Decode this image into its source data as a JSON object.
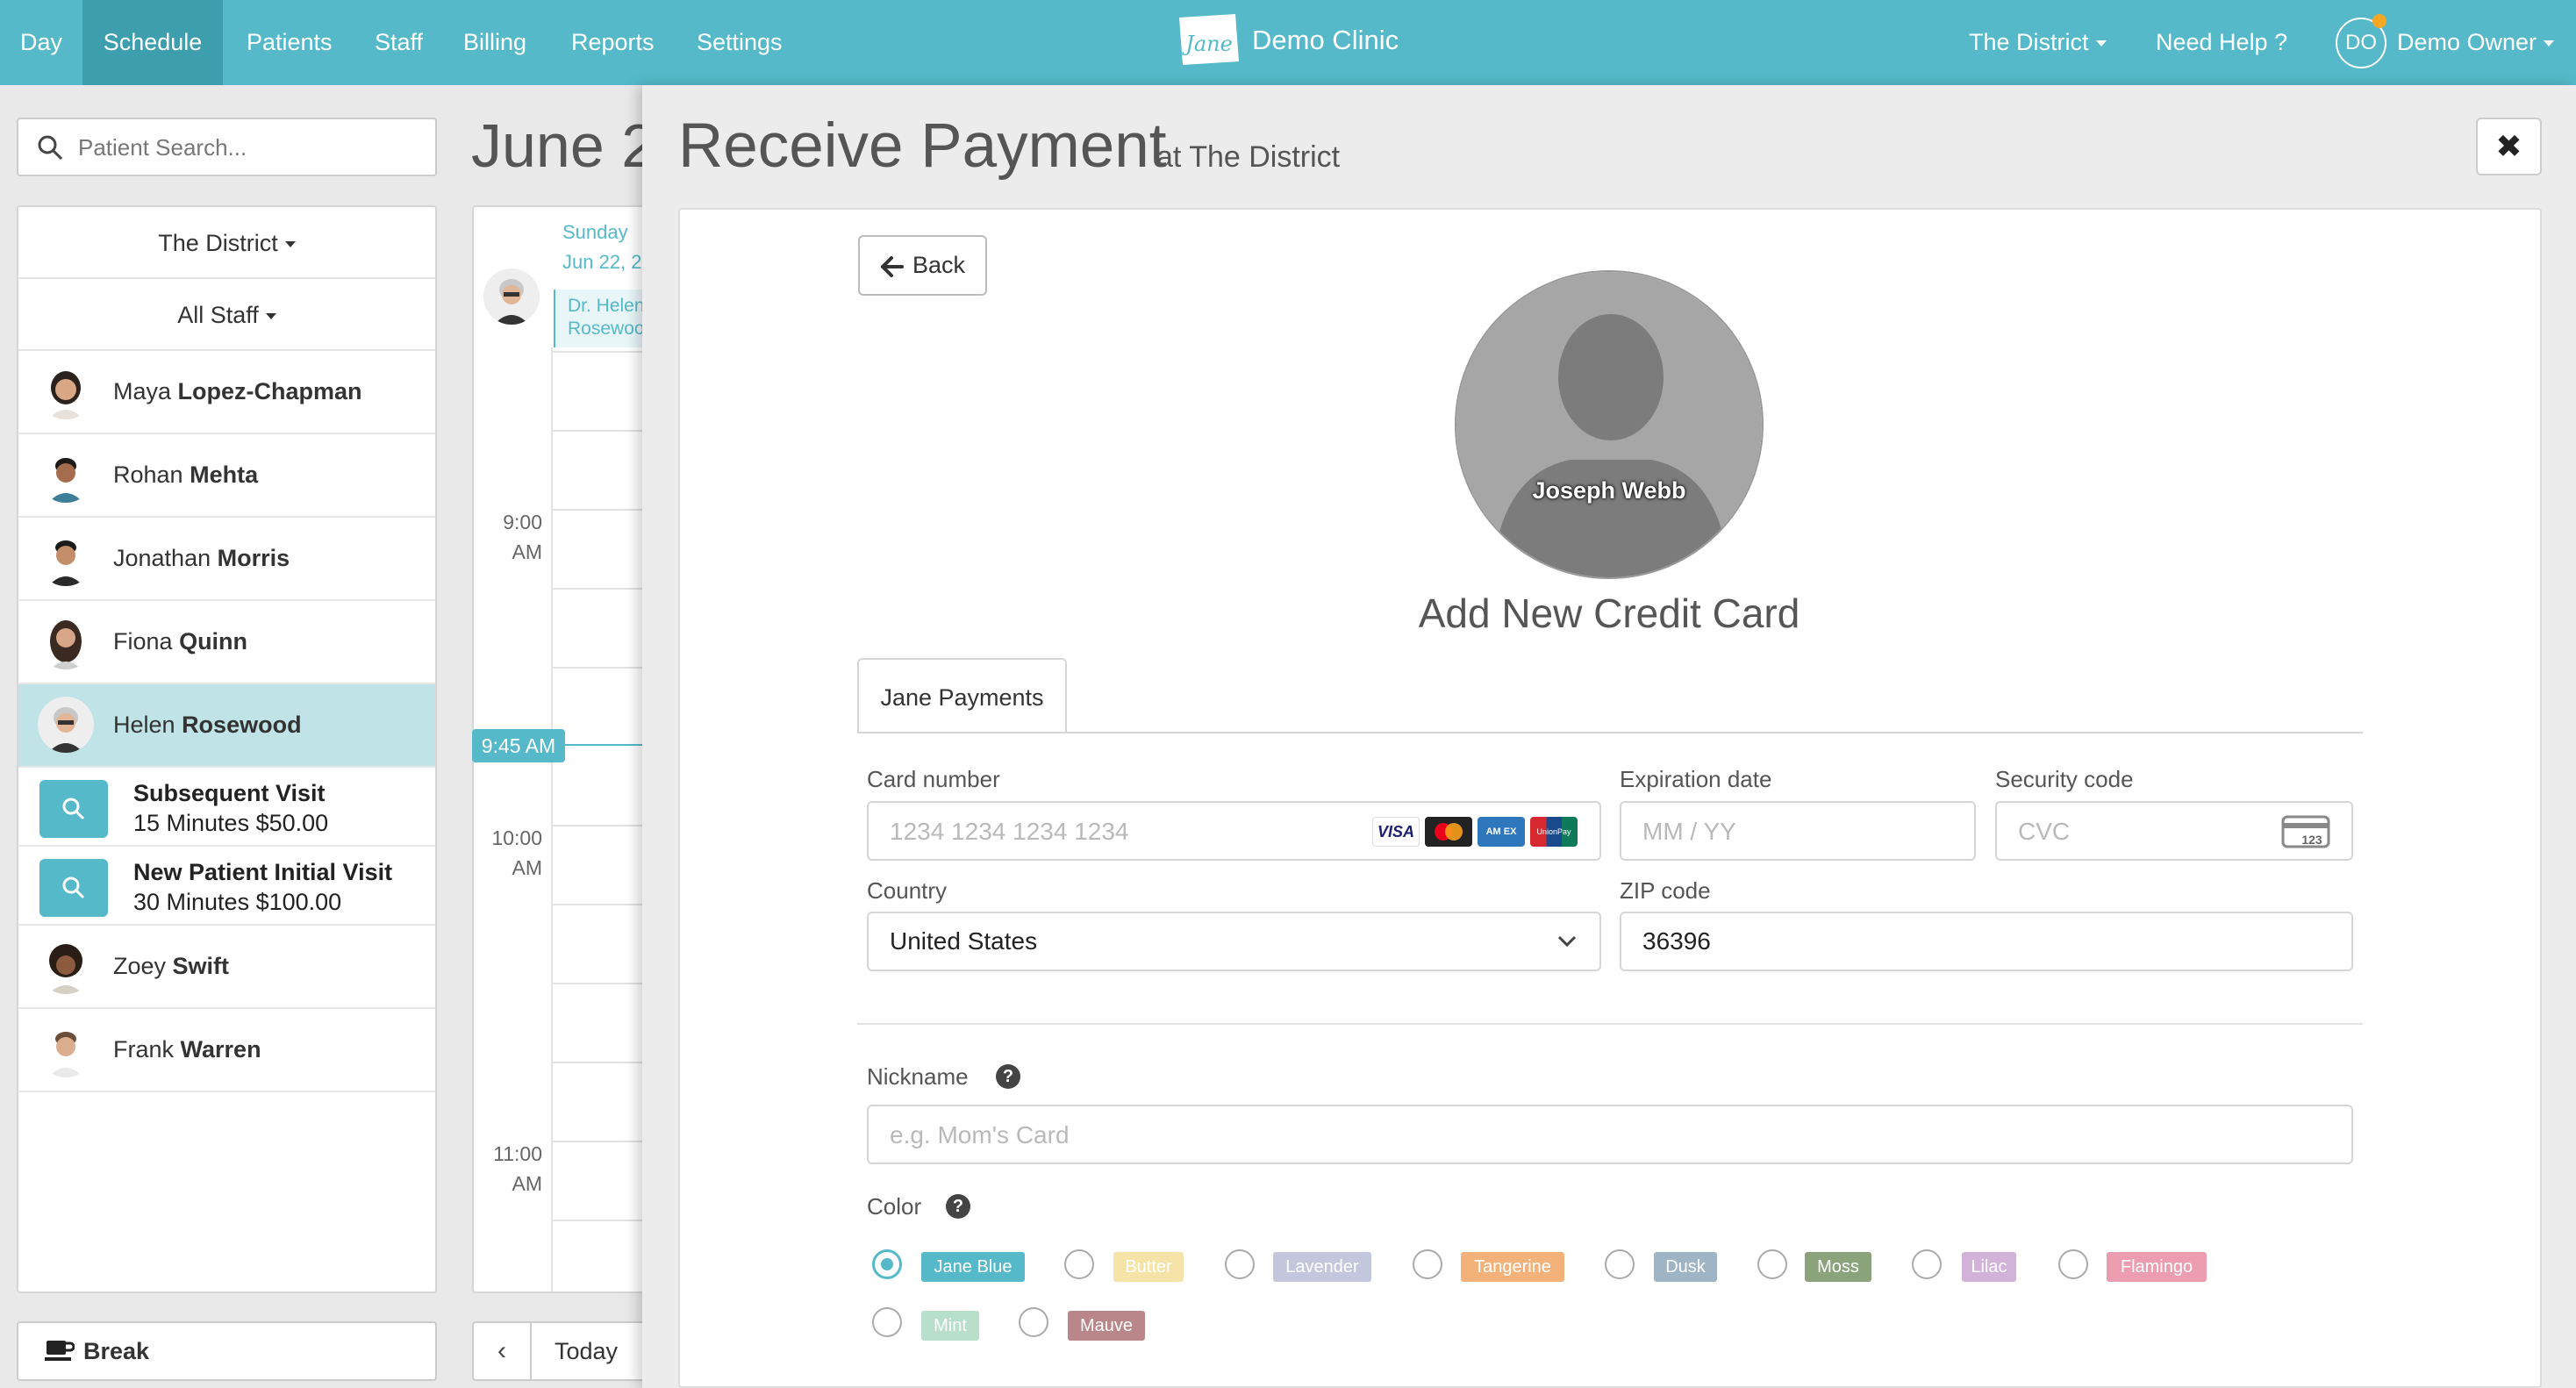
{
  "nav": {
    "items": [
      {
        "label": "Day"
      },
      {
        "label": "Schedule"
      },
      {
        "label": "Patients"
      },
      {
        "label": "Staff"
      },
      {
        "label": "Billing"
      },
      {
        "label": "Reports"
      },
      {
        "label": "Settings"
      }
    ],
    "logo_text": "Jane",
    "clinic_name": "Demo Clinic",
    "location": "The District",
    "help": "Need Help ?",
    "user_initials": "DO",
    "user_name": "Demo Owner"
  },
  "sidebar": {
    "search_placeholder": "Patient Search...",
    "location_filter": "The District",
    "staff_filter": "All Staff",
    "staff": [
      {
        "first": "Maya",
        "last": "Lopez-Chapman"
      },
      {
        "first": "Rohan",
        "last": "Mehta"
      },
      {
        "first": "Jonathan",
        "last": "Morris"
      },
      {
        "first": "Fiona",
        "last": "Quinn"
      },
      {
        "first": "Helen",
        "last": "Rosewood"
      },
      {
        "first": "Zoey",
        "last": "Swift"
      },
      {
        "first": "Frank",
        "last": "Warren"
      }
    ],
    "services": [
      {
        "title": "Subsequent Visit",
        "detail": "15 Minutes $50.00"
      },
      {
        "title": "New Patient Initial Visit",
        "detail": "30 Minutes $100.00"
      }
    ],
    "break_label": "Break"
  },
  "calendar": {
    "title": "June 2",
    "day_name": "Sunday",
    "day_date": "Jun 22, 2",
    "practitioner_line1": "Dr. Helen",
    "practitioner_line2": "Rosewood",
    "times": [
      {
        "hour": "9:00",
        "ampm": "AM"
      },
      {
        "hour": "10:00",
        "ampm": "AM"
      },
      {
        "hour": "11:00",
        "ampm": "AM"
      }
    ],
    "now_label": "9:45 AM",
    "today_label": "Today",
    "prev_symbol": "‹"
  },
  "modal": {
    "title": "Receive Payment",
    "subtitle": "at The District",
    "close_symbol": "✖",
    "back_label": "Back",
    "patient_name": "Joseph Webb",
    "section_title": "Add New Credit Card",
    "tab_label": "Jane Payments",
    "card_number_label": "Card number",
    "card_number_placeholder": "1234 1234 1234 1234",
    "expiry_label": "Expiration date",
    "expiry_placeholder": "MM / YY",
    "cvc_label": "Security code",
    "cvc_placeholder": "CVC",
    "cvc_icon_text": "123",
    "card_brands": [
      {
        "name": "visa-icon",
        "text": "VISA"
      },
      {
        "name": "mastercard-icon",
        "text": ""
      },
      {
        "name": "amex-icon",
        "text": "AM EX"
      },
      {
        "name": "unionpay-icon",
        "text": "UnionPay"
      }
    ],
    "country_label": "Country",
    "country_value": "United States",
    "zip_label": "ZIP code",
    "zip_value": "36396",
    "nickname_label": "Nickname",
    "nickname_placeholder": "e.g. Mom's Card",
    "color_label": "Color",
    "help_symbol": "?",
    "colors": [
      {
        "label": "Jane Blue",
        "hex": "#55b9c9",
        "selected": true
      },
      {
        "label": "Butter",
        "hex": "#f5e3a8",
        "selected": false
      },
      {
        "label": "Lavender",
        "hex": "#c3c6dd",
        "selected": false
      },
      {
        "label": "Tangerine",
        "hex": "#f2b27a",
        "selected": false
      },
      {
        "label": "Dusk",
        "hex": "#9fb4c4",
        "selected": false
      },
      {
        "label": "Moss",
        "hex": "#8aa37a",
        "selected": false
      },
      {
        "label": "Lilac",
        "hex": "#d2b2d8",
        "selected": false
      },
      {
        "label": "Flamingo",
        "hex": "#ec9db0",
        "selected": false
      },
      {
        "label": "Mint",
        "hex": "#b7dfcc",
        "selected": false
      },
      {
        "label": "Mauve",
        "hex": "#b98789",
        "selected": false
      }
    ]
  },
  "colors": {
    "brand": "#55b9c9",
    "brand_dark": "#3d9fae",
    "selected_row": "#bfe3e6"
  }
}
